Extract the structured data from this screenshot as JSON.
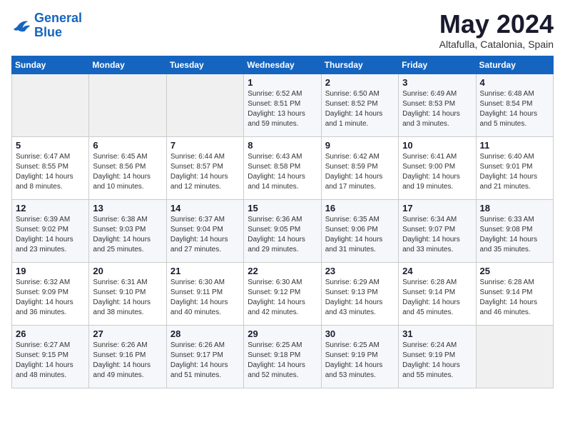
{
  "logo": {
    "line1": "General",
    "line2": "Blue"
  },
  "title": "May 2024",
  "subtitle": "Altafulla, Catalonia, Spain",
  "headers": [
    "Sunday",
    "Monday",
    "Tuesday",
    "Wednesday",
    "Thursday",
    "Friday",
    "Saturday"
  ],
  "weeks": [
    [
      {
        "day": "",
        "sunrise": "",
        "sunset": "",
        "daylight": ""
      },
      {
        "day": "",
        "sunrise": "",
        "sunset": "",
        "daylight": ""
      },
      {
        "day": "",
        "sunrise": "",
        "sunset": "",
        "daylight": ""
      },
      {
        "day": "1",
        "sunrise": "Sunrise: 6:52 AM",
        "sunset": "Sunset: 8:51 PM",
        "daylight": "Daylight: 13 hours and 59 minutes."
      },
      {
        "day": "2",
        "sunrise": "Sunrise: 6:50 AM",
        "sunset": "Sunset: 8:52 PM",
        "daylight": "Daylight: 14 hours and 1 minute."
      },
      {
        "day": "3",
        "sunrise": "Sunrise: 6:49 AM",
        "sunset": "Sunset: 8:53 PM",
        "daylight": "Daylight: 14 hours and 3 minutes."
      },
      {
        "day": "4",
        "sunrise": "Sunrise: 6:48 AM",
        "sunset": "Sunset: 8:54 PM",
        "daylight": "Daylight: 14 hours and 5 minutes."
      }
    ],
    [
      {
        "day": "5",
        "sunrise": "Sunrise: 6:47 AM",
        "sunset": "Sunset: 8:55 PM",
        "daylight": "Daylight: 14 hours and 8 minutes."
      },
      {
        "day": "6",
        "sunrise": "Sunrise: 6:45 AM",
        "sunset": "Sunset: 8:56 PM",
        "daylight": "Daylight: 14 hours and 10 minutes."
      },
      {
        "day": "7",
        "sunrise": "Sunrise: 6:44 AM",
        "sunset": "Sunset: 8:57 PM",
        "daylight": "Daylight: 14 hours and 12 minutes."
      },
      {
        "day": "8",
        "sunrise": "Sunrise: 6:43 AM",
        "sunset": "Sunset: 8:58 PM",
        "daylight": "Daylight: 14 hours and 14 minutes."
      },
      {
        "day": "9",
        "sunrise": "Sunrise: 6:42 AM",
        "sunset": "Sunset: 8:59 PM",
        "daylight": "Daylight: 14 hours and 17 minutes."
      },
      {
        "day": "10",
        "sunrise": "Sunrise: 6:41 AM",
        "sunset": "Sunset: 9:00 PM",
        "daylight": "Daylight: 14 hours and 19 minutes."
      },
      {
        "day": "11",
        "sunrise": "Sunrise: 6:40 AM",
        "sunset": "Sunset: 9:01 PM",
        "daylight": "Daylight: 14 hours and 21 minutes."
      }
    ],
    [
      {
        "day": "12",
        "sunrise": "Sunrise: 6:39 AM",
        "sunset": "Sunset: 9:02 PM",
        "daylight": "Daylight: 14 hours and 23 minutes."
      },
      {
        "day": "13",
        "sunrise": "Sunrise: 6:38 AM",
        "sunset": "Sunset: 9:03 PM",
        "daylight": "Daylight: 14 hours and 25 minutes."
      },
      {
        "day": "14",
        "sunrise": "Sunrise: 6:37 AM",
        "sunset": "Sunset: 9:04 PM",
        "daylight": "Daylight: 14 hours and 27 minutes."
      },
      {
        "day": "15",
        "sunrise": "Sunrise: 6:36 AM",
        "sunset": "Sunset: 9:05 PM",
        "daylight": "Daylight: 14 hours and 29 minutes."
      },
      {
        "day": "16",
        "sunrise": "Sunrise: 6:35 AM",
        "sunset": "Sunset: 9:06 PM",
        "daylight": "Daylight: 14 hours and 31 minutes."
      },
      {
        "day": "17",
        "sunrise": "Sunrise: 6:34 AM",
        "sunset": "Sunset: 9:07 PM",
        "daylight": "Daylight: 14 hours and 33 minutes."
      },
      {
        "day": "18",
        "sunrise": "Sunrise: 6:33 AM",
        "sunset": "Sunset: 9:08 PM",
        "daylight": "Daylight: 14 hours and 35 minutes."
      }
    ],
    [
      {
        "day": "19",
        "sunrise": "Sunrise: 6:32 AM",
        "sunset": "Sunset: 9:09 PM",
        "daylight": "Daylight: 14 hours and 36 minutes."
      },
      {
        "day": "20",
        "sunrise": "Sunrise: 6:31 AM",
        "sunset": "Sunset: 9:10 PM",
        "daylight": "Daylight: 14 hours and 38 minutes."
      },
      {
        "day": "21",
        "sunrise": "Sunrise: 6:30 AM",
        "sunset": "Sunset: 9:11 PM",
        "daylight": "Daylight: 14 hours and 40 minutes."
      },
      {
        "day": "22",
        "sunrise": "Sunrise: 6:30 AM",
        "sunset": "Sunset: 9:12 PM",
        "daylight": "Daylight: 14 hours and 42 minutes."
      },
      {
        "day": "23",
        "sunrise": "Sunrise: 6:29 AM",
        "sunset": "Sunset: 9:13 PM",
        "daylight": "Daylight: 14 hours and 43 minutes."
      },
      {
        "day": "24",
        "sunrise": "Sunrise: 6:28 AM",
        "sunset": "Sunset: 9:14 PM",
        "daylight": "Daylight: 14 hours and 45 minutes."
      },
      {
        "day": "25",
        "sunrise": "Sunrise: 6:28 AM",
        "sunset": "Sunset: 9:14 PM",
        "daylight": "Daylight: 14 hours and 46 minutes."
      }
    ],
    [
      {
        "day": "26",
        "sunrise": "Sunrise: 6:27 AM",
        "sunset": "Sunset: 9:15 PM",
        "daylight": "Daylight: 14 hours and 48 minutes."
      },
      {
        "day": "27",
        "sunrise": "Sunrise: 6:26 AM",
        "sunset": "Sunset: 9:16 PM",
        "daylight": "Daylight: 14 hours and 49 minutes."
      },
      {
        "day": "28",
        "sunrise": "Sunrise: 6:26 AM",
        "sunset": "Sunset: 9:17 PM",
        "daylight": "Daylight: 14 hours and 51 minutes."
      },
      {
        "day": "29",
        "sunrise": "Sunrise: 6:25 AM",
        "sunset": "Sunset: 9:18 PM",
        "daylight": "Daylight: 14 hours and 52 minutes."
      },
      {
        "day": "30",
        "sunrise": "Sunrise: 6:25 AM",
        "sunset": "Sunset: 9:19 PM",
        "daylight": "Daylight: 14 hours and 53 minutes."
      },
      {
        "day": "31",
        "sunrise": "Sunrise: 6:24 AM",
        "sunset": "Sunset: 9:19 PM",
        "daylight": "Daylight: 14 hours and 55 minutes."
      },
      {
        "day": "",
        "sunrise": "",
        "sunset": "",
        "daylight": ""
      }
    ]
  ]
}
